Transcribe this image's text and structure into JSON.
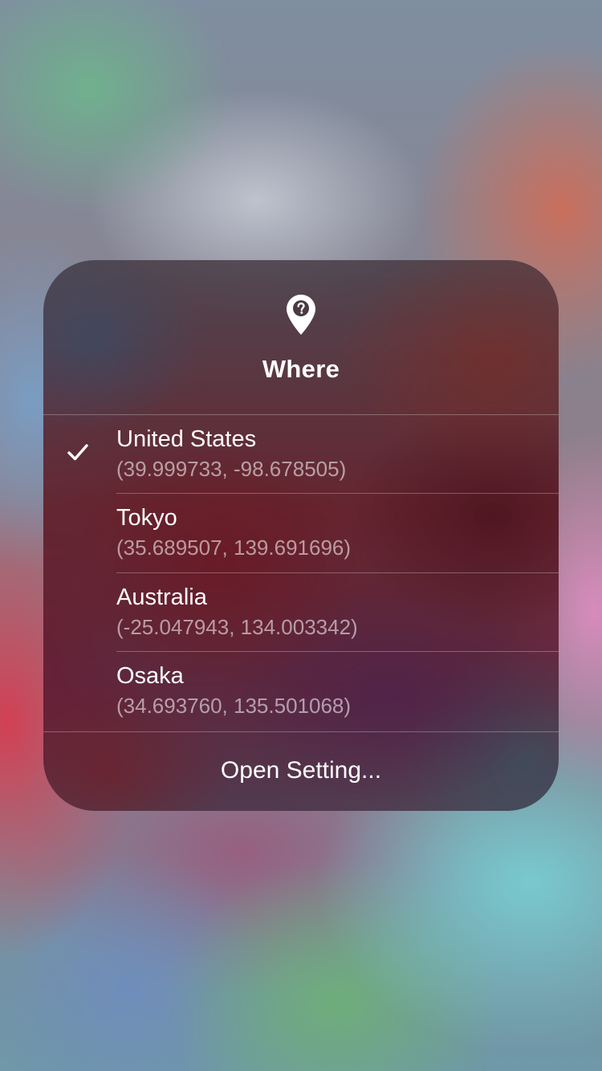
{
  "menu": {
    "icon": "location-pin-question-icon",
    "title": "Where",
    "locations": [
      {
        "name": "United States",
        "coords": "(39.999733, -98.678505)",
        "selected": true
      },
      {
        "name": "Tokyo",
        "coords": "(35.689507, 139.691696)",
        "selected": false
      },
      {
        "name": "Australia",
        "coords": "(-25.047943, 134.003342)",
        "selected": false
      },
      {
        "name": "Osaka",
        "coords": "(34.693760, 135.501068)",
        "selected": false
      }
    ],
    "action_label": "Open Setting..."
  },
  "colors": {
    "text": "#ffffff",
    "secondary_text": "rgba(255,255,255,0.55)"
  }
}
